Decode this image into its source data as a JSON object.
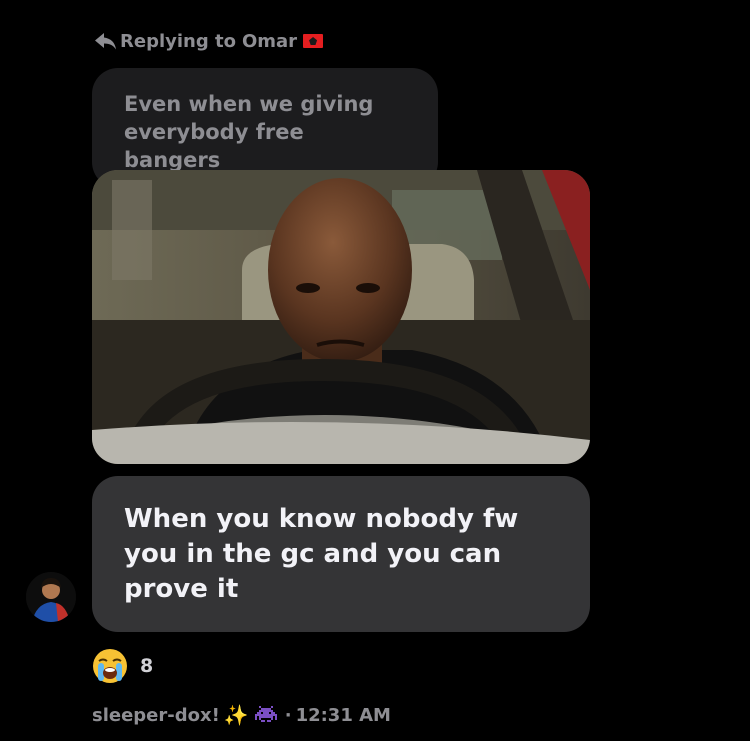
{
  "reply": {
    "prefix": "Replying to",
    "name": "Omar",
    "icon": "reply-arrow-icon",
    "flag": "albania-flag-icon"
  },
  "quoted_message": {
    "text": "Even when we giving\neverybody free bangers"
  },
  "photo": {
    "kind": "image",
    "description_icon": "photo-man-in-car"
  },
  "message": {
    "text": "When you know nobody fw\nyou in the gc and you can\nprove it"
  },
  "reaction": {
    "emoji": "loudly-crying-face-icon",
    "count": "8"
  },
  "meta": {
    "username": "sleeper-dox!",
    "sparkles_icon": "sparkles-icon",
    "invader_icon": "space-invader-icon",
    "separator": "·",
    "time": "12:31 AM"
  },
  "colors": {
    "background": "#000000",
    "quoted_bubble": "#1c1c1e",
    "message_bubble": "#343436",
    "secondary_text": "#8e8e93",
    "primary_text": "#f2f2f7"
  }
}
